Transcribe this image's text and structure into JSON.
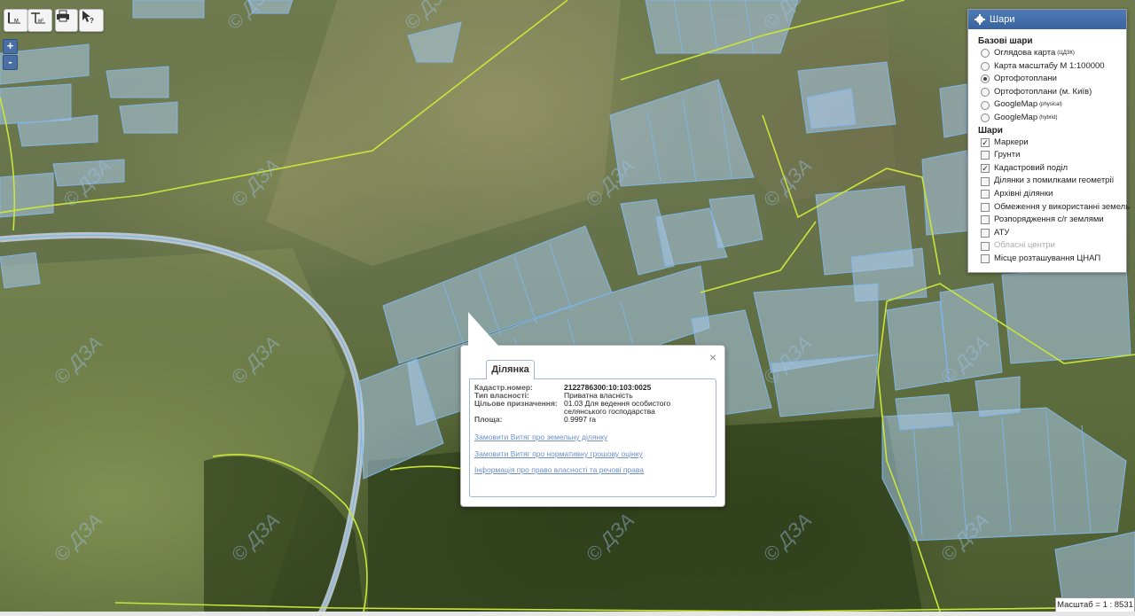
{
  "toolbar": {
    "btn1_label": "м",
    "btn2_label": "м²",
    "print_icon": "printer-icon",
    "help_icon": "help-cursor-icon"
  },
  "zoom": {
    "in_label": "+",
    "out_label": "-"
  },
  "watermark": {
    "text": "© ДЗА"
  },
  "layers_panel": {
    "title": "Шари",
    "base_section": "Базові шари",
    "base_layers": [
      {
        "label": "Оглядова карта",
        "sup": "(ЦДЗК)",
        "selected": false
      },
      {
        "label": "Карта масштабу М 1:100000",
        "sup": "",
        "selected": false
      },
      {
        "label": "Ортофотоплани",
        "sup": "",
        "selected": true
      },
      {
        "label": "Ортофотоплани (м. Київ)",
        "sup": "",
        "selected": false
      },
      {
        "label": "GoogleMap",
        "sup": "(physical)",
        "selected": false
      },
      {
        "label": "GoogleMap",
        "sup": "(hybrid)",
        "selected": false
      }
    ],
    "overlay_section": "Шари",
    "overlay_layers": [
      {
        "label": "Маркери",
        "checked": true,
        "disabled": false
      },
      {
        "label": "Грунти",
        "checked": false,
        "disabled": false
      },
      {
        "label": "Кадастровий поділ",
        "checked": true,
        "disabled": false
      },
      {
        "label": "Ділянки з помилками геометрії",
        "checked": false,
        "disabled": false
      },
      {
        "label": "Архівні ділянки",
        "checked": false,
        "disabled": false
      },
      {
        "label": "Обмеження у використанні земель",
        "checked": false,
        "disabled": false
      },
      {
        "label": "Розпорядження с/г землями",
        "checked": false,
        "disabled": false
      },
      {
        "label": "АТУ",
        "checked": false,
        "disabled": false
      },
      {
        "label": "Обласні центри",
        "checked": false,
        "disabled": true
      },
      {
        "label": "Місце розташування ЦНАП",
        "checked": false,
        "disabled": false
      }
    ]
  },
  "popup": {
    "tab_label": "Ділянка",
    "close_label": "×",
    "fields": [
      {
        "key": "Кадастр.номер:",
        "value": "2122786300:10:103:0025"
      },
      {
        "key": "Тип власності:",
        "value": "Приватна власність"
      },
      {
        "key": "Цільове призначення:",
        "value": "01.03 Для ведення особистого селянського господарства"
      },
      {
        "key": "Площа:",
        "value": "0.9997 га"
      }
    ],
    "links": [
      "Замовити Витяг про земельну ділянку",
      "Замовити Витяг про нормативну грошову оцінку",
      "Інформація про право власності та речові права"
    ]
  },
  "scale": {
    "text": "Масштаб = 1 : 8531"
  },
  "colors": {
    "parcel_fill": "#a9c8e8",
    "parcel_stroke": "#7fb6ea",
    "boundary": "#c8e63a",
    "accent": "#3a64a0"
  }
}
